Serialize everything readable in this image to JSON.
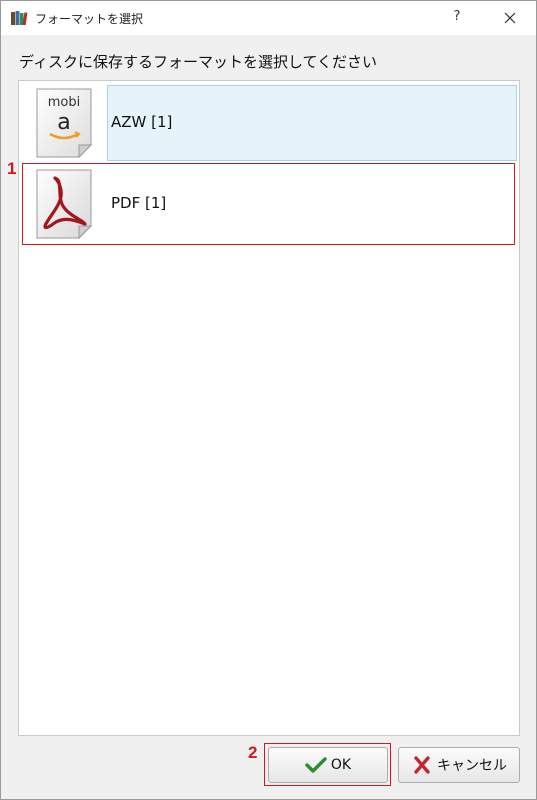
{
  "window": {
    "title": "フォーマットを選択",
    "help_label": "?",
    "close_label": "✕"
  },
  "instruction": "ディスクに保存するフォーマットを選択してください",
  "formats": [
    {
      "label": "AZW [1]",
      "icon": "mobi-amazon-icon",
      "icon_text_top": "mobi",
      "icon_text_main": "a",
      "selected": true
    },
    {
      "label": "PDF [1]",
      "icon": "pdf-acrobat-icon",
      "selected": false
    }
  ],
  "annotations": {
    "marker_1": "1",
    "marker_2": "2",
    "color": "#d0191f"
  },
  "buttons": {
    "ok_label": "OK",
    "cancel_label": "キャンセル"
  },
  "colors": {
    "selection_bg": "#e5f3fb",
    "selection_border": "#a3d3ef",
    "ok_check": "#2e8b2e",
    "cancel_x": "#c1272d"
  }
}
